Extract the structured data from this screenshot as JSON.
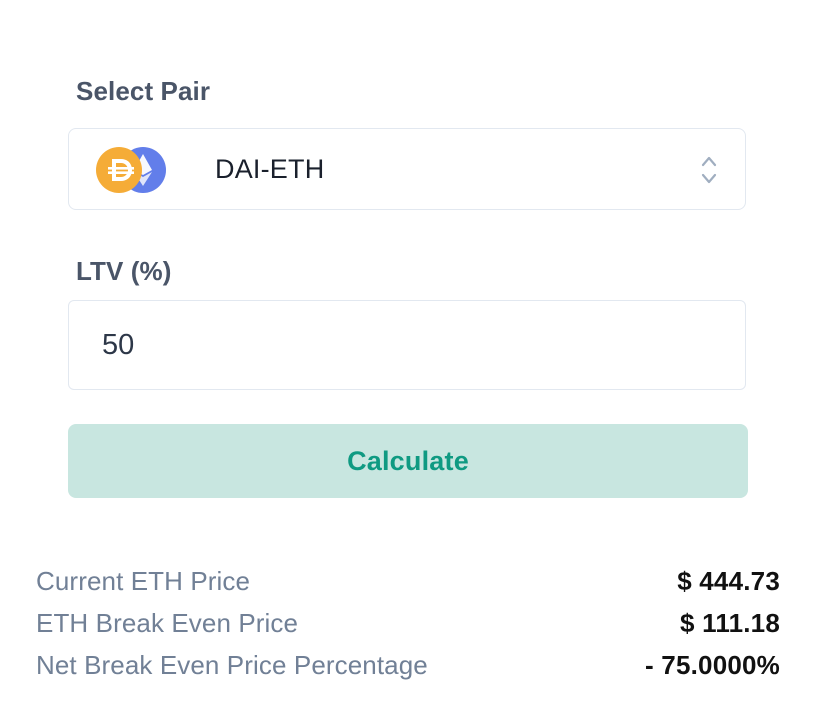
{
  "form": {
    "pair_label": "Select Pair",
    "pair": {
      "selected": "DAI-ETH",
      "base_icon": "dai-icon",
      "quote_icon": "eth-icon"
    },
    "ltv_label": "LTV (%)",
    "ltv_value": "50",
    "calculate_label": "Calculate"
  },
  "results": [
    {
      "label": "Current ETH Price",
      "value": "$ 444.73"
    },
    {
      "label": "ETH Break Even Price",
      "value": "$ 111.18"
    },
    {
      "label": "Net Break Even Price Percentage",
      "value": "- 75.0000%"
    }
  ],
  "colors": {
    "accent": "#0f9a82",
    "button_bg": "#c8e6e0",
    "dai": "#f5ac37",
    "eth": "#627eea"
  }
}
